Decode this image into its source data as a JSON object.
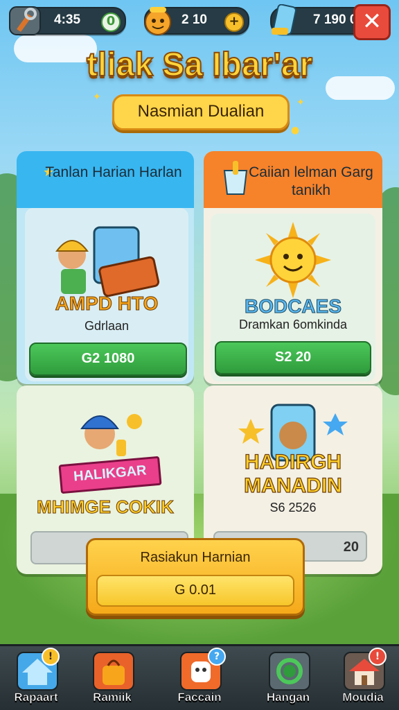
{
  "top_bar": {
    "tools_value": "4:35",
    "tools_plus": "0",
    "coins_value": "2 10",
    "coins_plus": "+",
    "phone_value": "7 190 0",
    "close_label": "✕"
  },
  "title": "tliak Sa Ibar'ar",
  "subtitle": "Nasmian Dualian",
  "panels": {
    "left": {
      "header": "Tanlan Harian Harlan"
    },
    "right": {
      "header": "Caiian lelman Garg tanikh"
    }
  },
  "cards": [
    {
      "name": "AMPD HTO",
      "desc": "Gdrlaan",
      "button": "G2 1080"
    },
    {
      "name": "BODCAES",
      "desc": "Dramkan 6omkinda",
      "button": "S2 20"
    },
    {
      "name": "HALIKGAR",
      "name2": "MHIMGE COKIK",
      "button": ""
    },
    {
      "name": "HADIRGH MANADIN",
      "desc": "S6 2526",
      "button": "20"
    }
  ],
  "popup": {
    "title": "Rasiakun Harnian",
    "button": "G 0.01"
  },
  "nav": [
    {
      "label": "Rapaart",
      "badge": "!"
    },
    {
      "label": "Ramiik",
      "badge": ""
    },
    {
      "label": "Faccain",
      "badge": "?"
    },
    {
      "label": "Hangan",
      "badge": ""
    },
    {
      "label": "Moudia",
      "badge": "!"
    }
  ],
  "colors": {
    "left_header": "#38b6f0",
    "right_header": "#f6822a",
    "green_button": "#2f9b3c",
    "popup": "#f5a91a",
    "close": "#e84b3b"
  }
}
